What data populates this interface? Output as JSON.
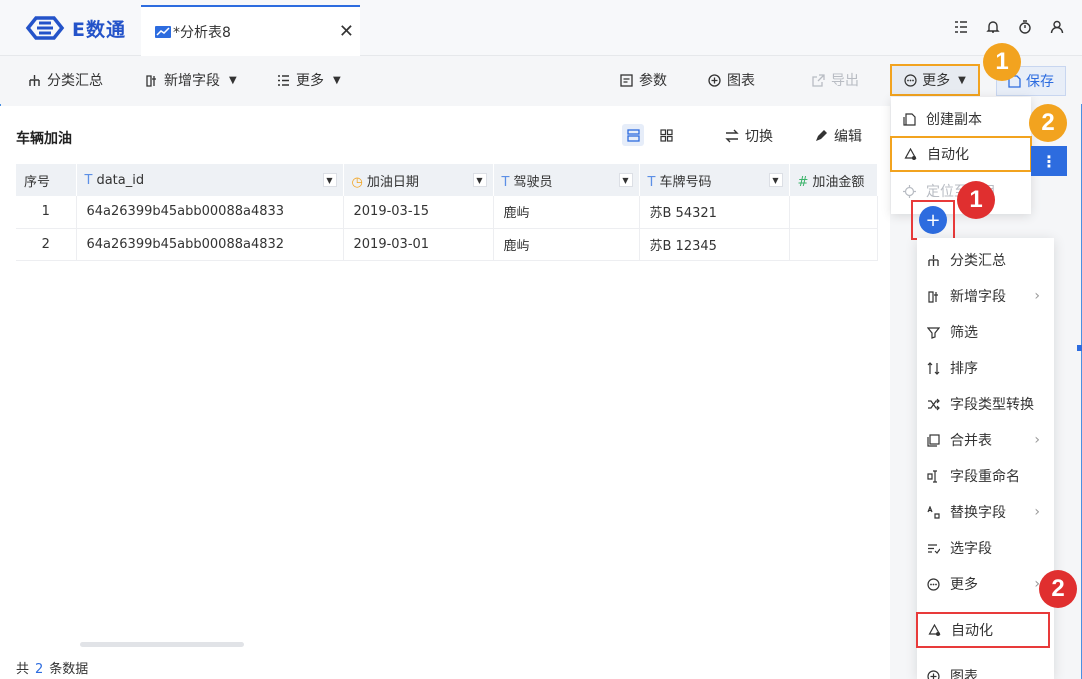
{
  "app": {
    "logo_text": "E数通"
  },
  "tab": {
    "label": "*分析表8",
    "close": "✕"
  },
  "toolbar": {
    "group_summary": "分类汇总",
    "add_field": "新增字段",
    "more": "更多",
    "params": "参数",
    "chart": "图表",
    "export": "导出",
    "more_btn": "更多",
    "save": "保存"
  },
  "panel": {
    "title": "车辆加油",
    "switch": "切换",
    "edit": "编辑"
  },
  "table": {
    "columns": [
      {
        "name": "序号",
        "icon": ""
      },
      {
        "name": "data_id",
        "icon": "T"
      },
      {
        "name": "加油日期",
        "icon": "◷"
      },
      {
        "name": "驾驶员",
        "icon": "T"
      },
      {
        "name": "车牌号码",
        "icon": "T"
      },
      {
        "name": "加油金额",
        "icon": "#"
      }
    ],
    "rows": [
      [
        "1",
        "64a26399b45abb00088a4833",
        "2019-03-15",
        "鹿屿",
        "苏B 54321",
        ""
      ],
      [
        "2",
        "64a26399b45abb00088a4832",
        "2019-03-01",
        "鹿屿",
        "苏B 12345",
        ""
      ]
    ]
  },
  "footer": {
    "prefix": "共",
    "count": "2",
    "suffix": "条数据"
  },
  "dropdown1": {
    "items": [
      "创建副本",
      "自动化",
      "定位至项目"
    ]
  },
  "menu2": {
    "items": [
      "分类汇总",
      "新增字段",
      "筛选",
      "排序",
      "字段类型转换",
      "合并表",
      "字段重命名",
      "替换字段",
      "选字段",
      "更多",
      "自动化",
      "图表"
    ]
  },
  "badges": {
    "one": "1",
    "two": "2"
  },
  "plus": "+",
  "kebab": "⋮",
  "colors": {
    "accent": "#2d6cdf",
    "highlight_orange": "#f2a31f",
    "highlight_red": "#e02f2f"
  }
}
